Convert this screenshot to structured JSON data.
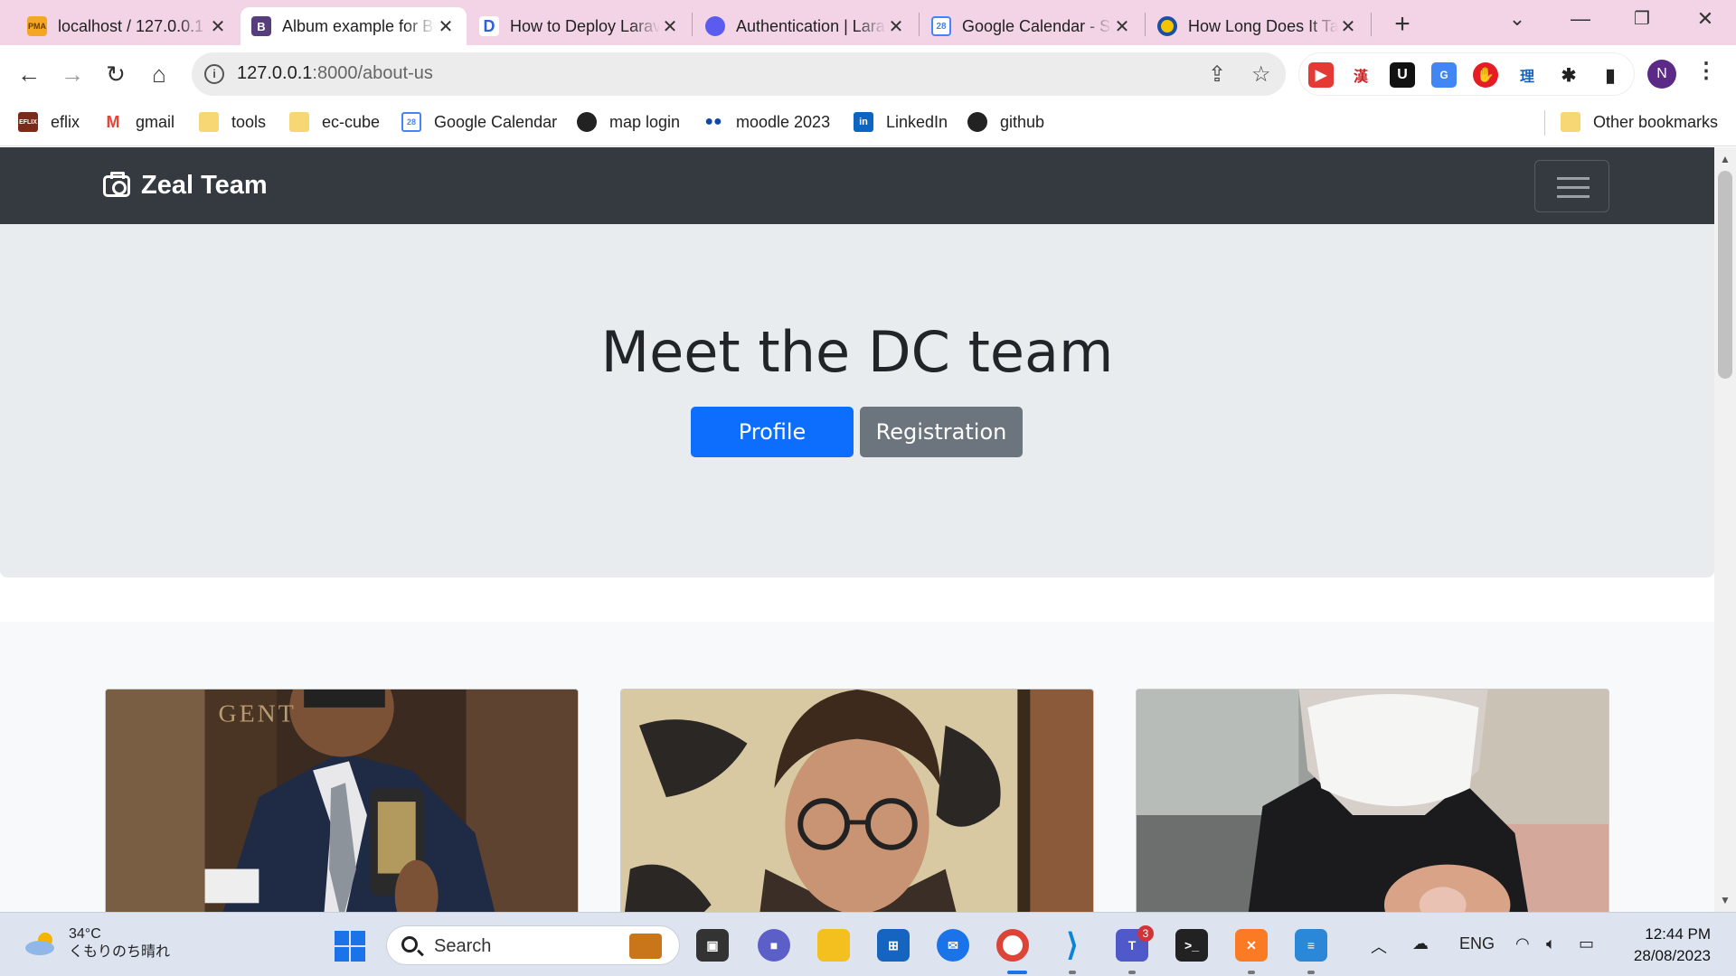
{
  "browser": {
    "tabs": [
      {
        "title": "localhost / 127.0.0.1",
        "favicon": "phpmyadmin-icon",
        "active": false
      },
      {
        "title": "Album example for Bootstrap",
        "favicon": "bootstrap-icon",
        "active": true
      },
      {
        "title": "How to Deploy Laravel",
        "favicon": "deploy-icon",
        "active": false
      },
      {
        "title": "Authentication | Laravel",
        "favicon": "laravel-docs-icon",
        "active": false
      },
      {
        "title": "Google Calendar - Sign in",
        "favicon": "google-calendar-icon",
        "active": false
      },
      {
        "title": "How Long Does It Take",
        "favicon": "circle-icon",
        "active": false
      }
    ],
    "url_host": "127.0.0.1",
    "url_rest": ":8000/about-us",
    "profile_initial": "N",
    "bookmarks": [
      {
        "label": "eflix",
        "icon": "eflix-icon"
      },
      {
        "label": "gmail",
        "icon": "gmail-icon"
      },
      {
        "label": "tools",
        "icon": "folder-icon"
      },
      {
        "label": "ec-cube",
        "icon": "folder-icon"
      },
      {
        "label": "Google Calendar",
        "icon": "google-calendar-icon"
      },
      {
        "label": "map login",
        "icon": "globe-icon"
      },
      {
        "label": "moodle 2023",
        "icon": "moodle-icon"
      },
      {
        "label": "LinkedIn",
        "icon": "linkedin-icon"
      },
      {
        "label": "github",
        "icon": "github-icon"
      }
    ],
    "other_bookmarks": "Other bookmarks"
  },
  "site": {
    "brand": "Zeal Team",
    "hero_title": "Meet the DC team",
    "buttons": {
      "primary": "Profile",
      "secondary": "Registration"
    },
    "accent": "#0d6efd",
    "navbar_color": "#343a40"
  },
  "taskbar": {
    "weather_temp": "34°C",
    "weather_desc": "くもりのち晴れ",
    "search_label": "Search",
    "teams_badge": "3",
    "language": "ENG",
    "time": "12:44 PM",
    "date": "28/08/2023"
  }
}
